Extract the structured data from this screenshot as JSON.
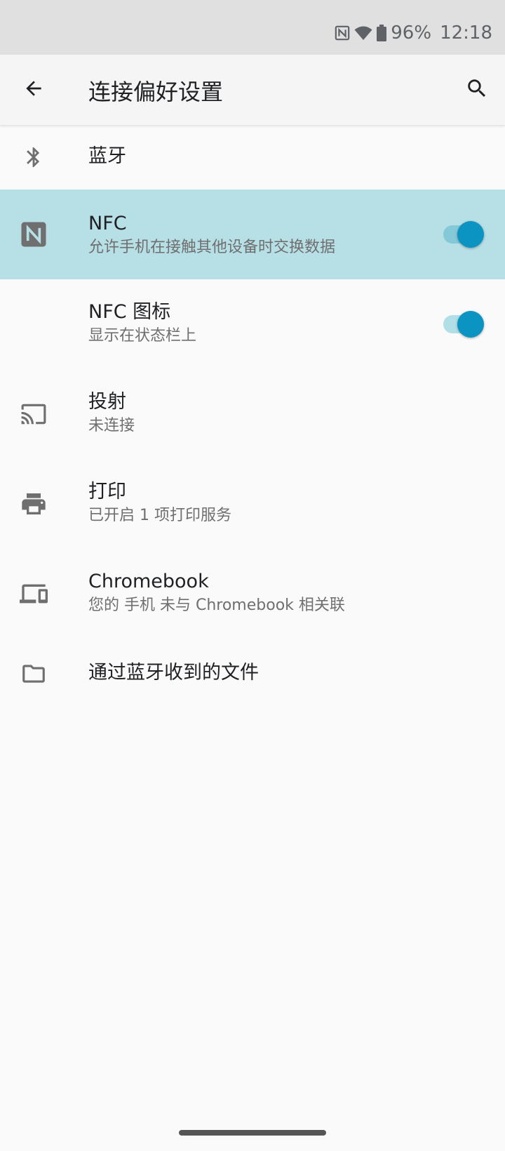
{
  "status_bar": {
    "battery_text": "96%",
    "time": "12:18",
    "icons": [
      "nfc-icon",
      "wifi-icon",
      "battery-icon"
    ]
  },
  "app_bar": {
    "title": "连接偏好设置",
    "back_icon": "arrow-back-icon",
    "search_icon": "search-icon"
  },
  "items": [
    {
      "icon": "bluetooth-icon",
      "label": "蓝牙"
    },
    {
      "icon": "nfc-icon",
      "label": "NFC",
      "subtitle": "允许手机在接触其他设备时交换数据",
      "toggle_on": true,
      "highlighted": true
    },
    {
      "label": "NFC 图标",
      "subtitle": "显示在状态栏上",
      "toggle_on": true
    },
    {
      "icon": "cast-icon",
      "label": "投射",
      "subtitle": "未连接"
    },
    {
      "icon": "printer-icon",
      "label": "打印",
      "subtitle": "已开启 1 项打印服务"
    },
    {
      "icon": "devices-icon",
      "label": "Chromebook",
      "subtitle": "您的 手机 未与 Chromebook 相关联"
    },
    {
      "icon": "folder-icon",
      "label": "通过蓝牙收到的文件"
    }
  ],
  "colors": {
    "accent": "#0b93c1",
    "highlight_row": "#b7dfe6",
    "background": "#fafafa"
  }
}
